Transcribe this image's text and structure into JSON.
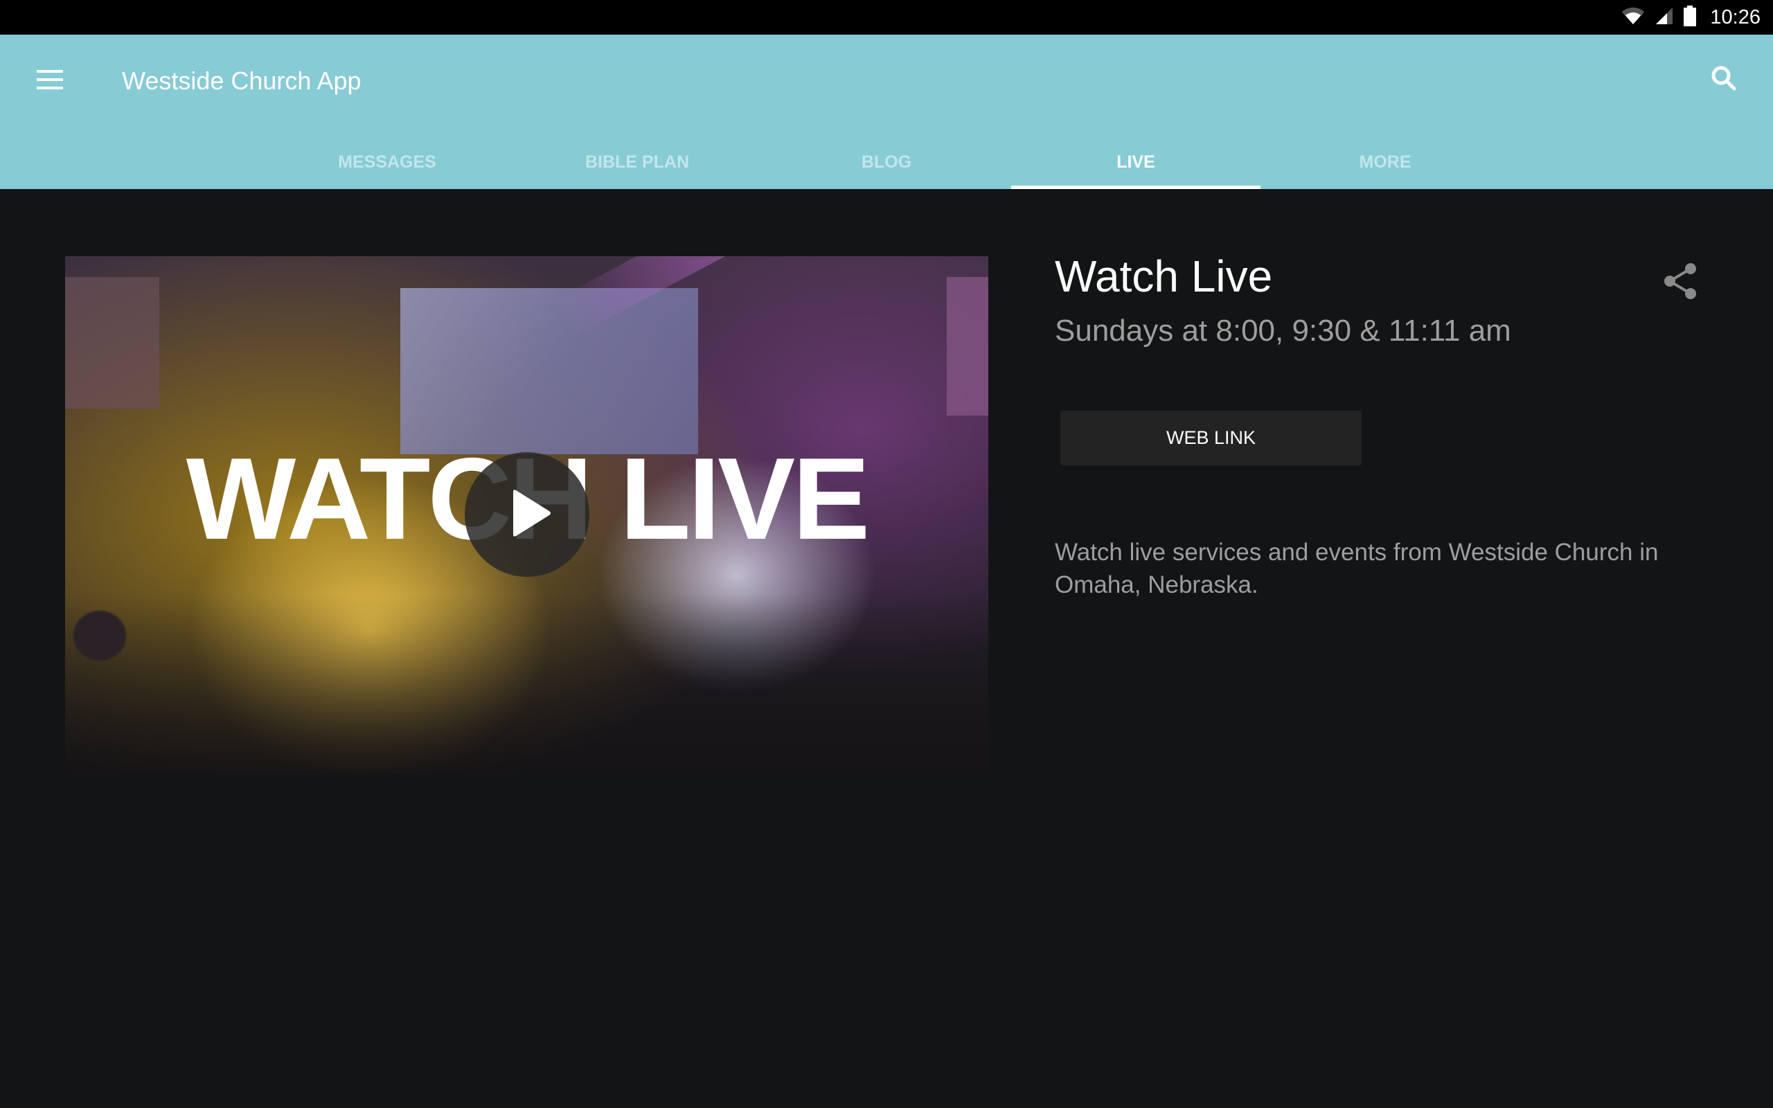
{
  "status_bar": {
    "time": "10:26",
    "icons": [
      "wifi-icon",
      "cell-signal-icon",
      "battery-icon"
    ]
  },
  "app_bar": {
    "title": "Westside Church App",
    "menu_icon": "hamburger-menu-icon",
    "search_icon": "search-icon",
    "background_color": "#87cbd5"
  },
  "tabs": [
    {
      "label": "MESSAGES",
      "active": false
    },
    {
      "label": "BIBLE PLAN",
      "active": false
    },
    {
      "label": "BLOG",
      "active": false
    },
    {
      "label": "LIVE",
      "active": true
    },
    {
      "label": "MORE",
      "active": false
    }
  ],
  "hero": {
    "overlay_text": "WATCH LIVE",
    "play_icon": "play-icon"
  },
  "detail": {
    "title": "Watch Live",
    "subtitle": "Sundays at 8:00, 9:30 & 11:11 am",
    "share_icon": "share-icon",
    "web_link_label": "WEB LINK",
    "description": "Watch live services and events from Westside Church in Omaha, Nebraska."
  }
}
